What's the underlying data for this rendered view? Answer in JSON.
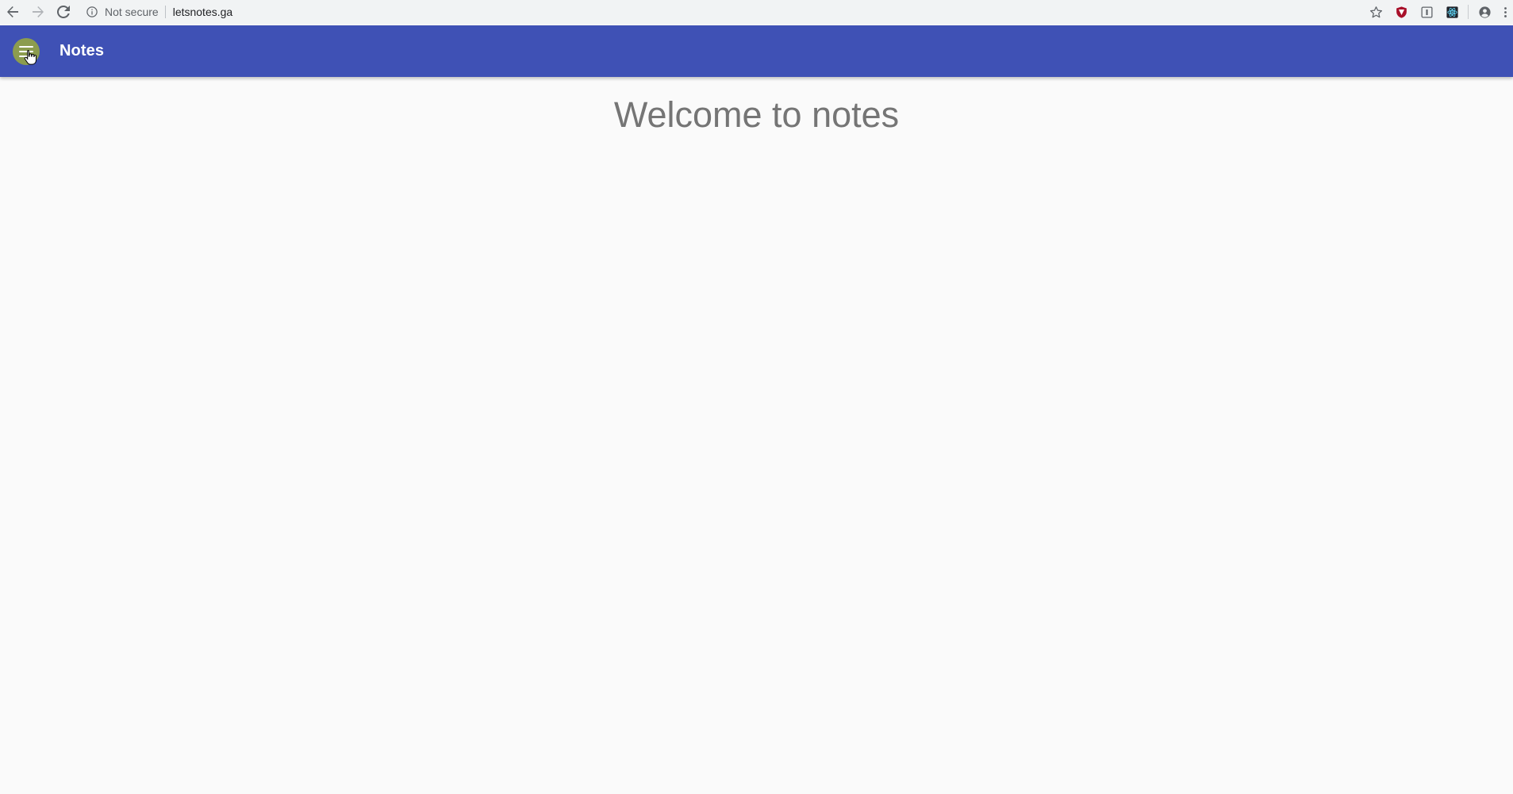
{
  "browser": {
    "security_text": "Not secure",
    "url": "letsnotes.ga"
  },
  "app_bar": {
    "title": "Notes",
    "color": "#3f51b5",
    "menu_button_color": "#8c9c4f"
  },
  "main": {
    "heading": "Welcome to notes"
  },
  "icons": [
    "back-arrow-icon",
    "forward-arrow-icon",
    "reload-icon",
    "info-icon",
    "star-icon",
    "shield-extension-icon",
    "reader-extension-icon",
    "react-extension-icon",
    "account-icon",
    "more-vert-icon",
    "hamburger-menu-icon",
    "hand-cursor-icon"
  ]
}
